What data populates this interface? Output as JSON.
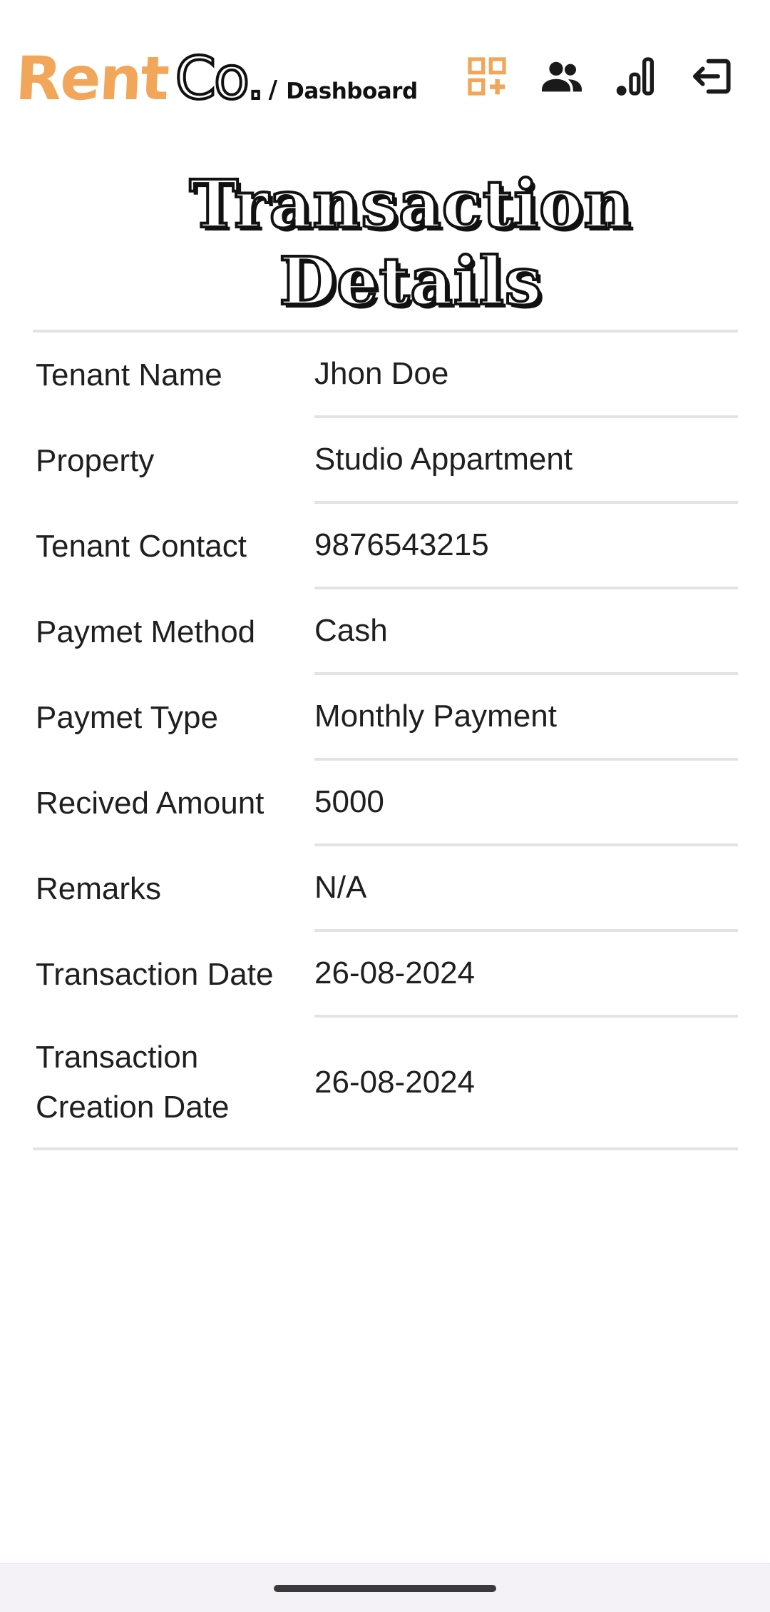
{
  "header": {
    "brand_rent": "Rent",
    "brand_co": "Co.",
    "separator": "/",
    "breadcrumb": "Dashboard",
    "icons": [
      "qr-add-icon",
      "users-icon",
      "signal-bars-icon",
      "logout-icon"
    ],
    "accent_color": "#f2a65a"
  },
  "page_title": "Transaction Details",
  "details": [
    {
      "label": "Tenant Name",
      "value": "Jhon Doe"
    },
    {
      "label": "Property",
      "value": "Studio Appartment"
    },
    {
      "label": "Tenant Contact",
      "value": "9876543215"
    },
    {
      "label": "Paymet Method",
      "value": "Cash"
    },
    {
      "label": "Paymet Type",
      "value": "Monthly Payment"
    },
    {
      "label": "Recived Amount",
      "value": "5000"
    },
    {
      "label": "Remarks",
      "value": "N/A"
    },
    {
      "label": "Transaction Date",
      "value": "26-08-2024"
    },
    {
      "label": "Transaction Creation Date",
      "value": "26-08-2024"
    }
  ]
}
